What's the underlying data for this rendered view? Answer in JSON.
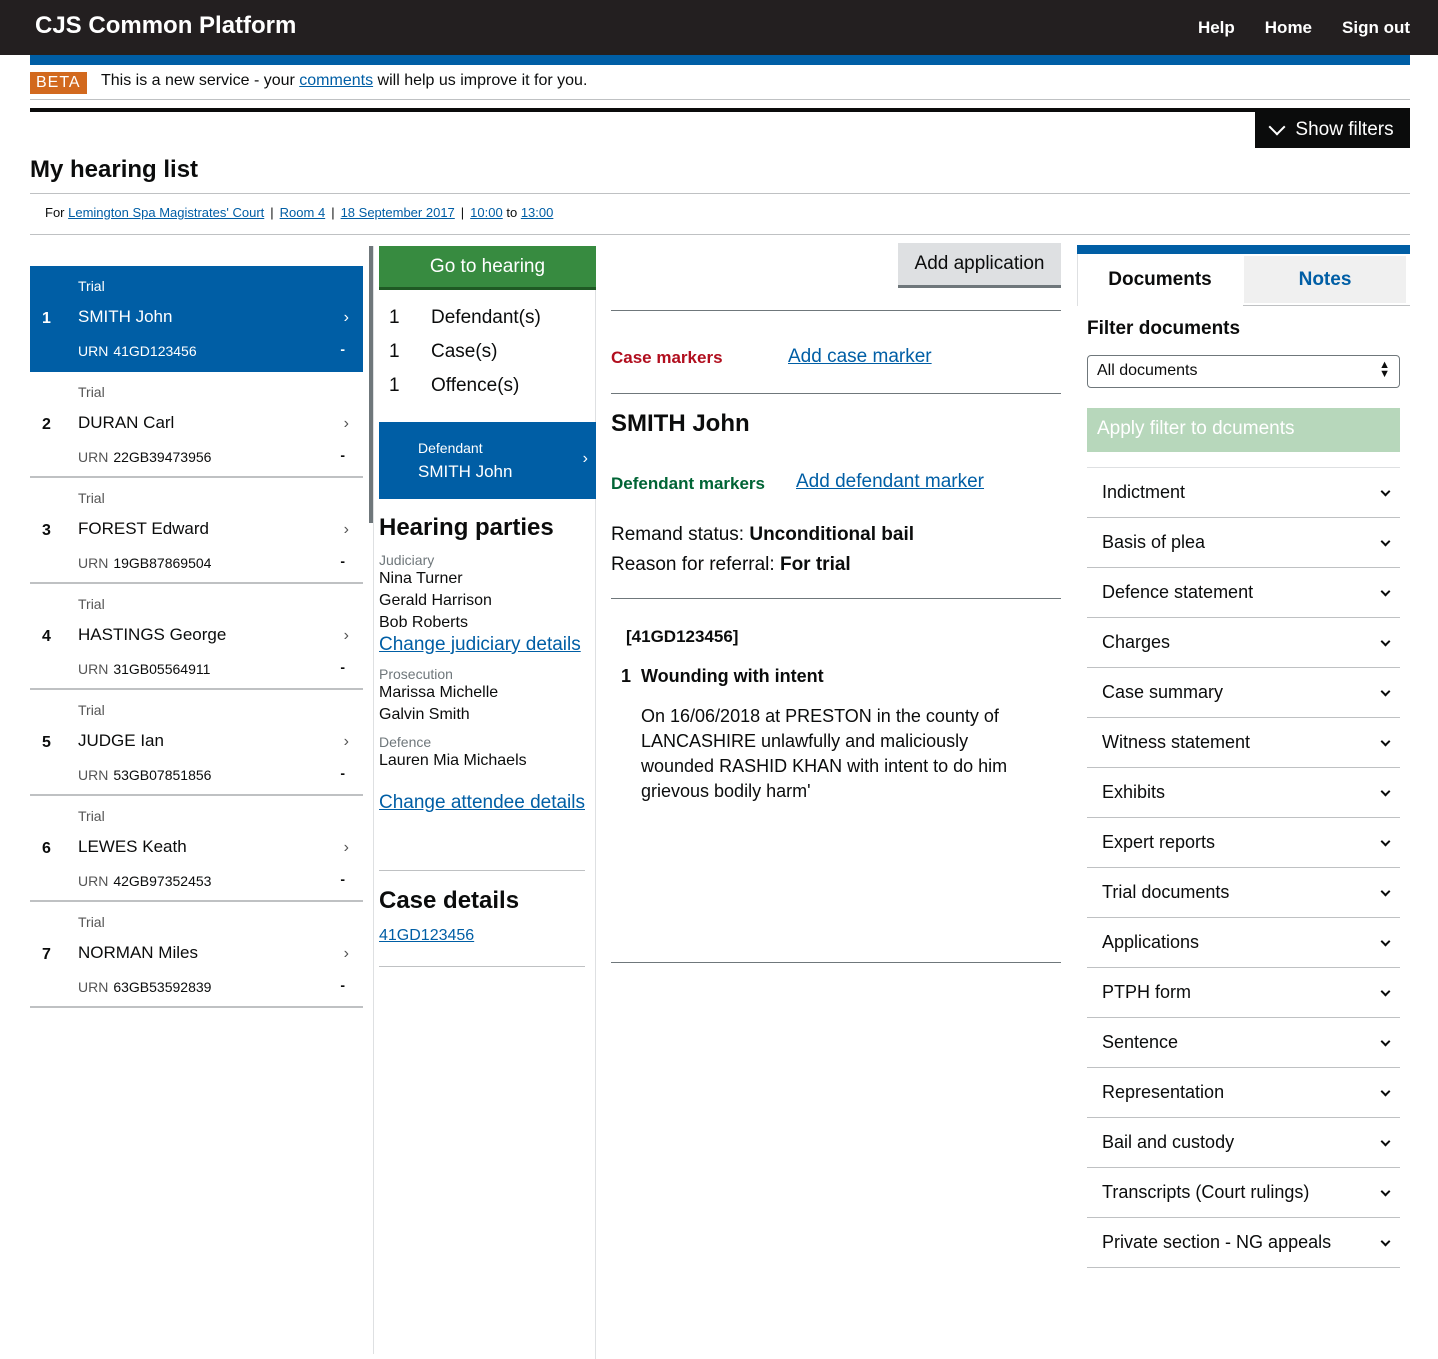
{
  "header": {
    "brand": "CJS Common Platform",
    "nav": [
      "Help",
      "Home",
      "Sign out"
    ],
    "brand_color": "#231f20",
    "accent_color": "#005ea5"
  },
  "beta": {
    "tag": "BETA",
    "text_before": "This is a new service - your ",
    "link": "comments",
    "text_after": " will help us improve it for you."
  },
  "filters": {
    "show_label": "Show filters",
    "icon": "chevron-down-icon"
  },
  "page": {
    "title": "My hearing list",
    "context": {
      "for_label": "For",
      "court": "Lemington Spa Magistrates' Court",
      "room": "Room 4",
      "date": "18 September 2017",
      "start": "10:00",
      "to_label": "to",
      "end": "13:00"
    }
  },
  "hearings": [
    {
      "num": "1",
      "type": "Trial",
      "name": "SMITH John",
      "urn_label": "URN",
      "urn": "41GD123456",
      "status": "-"
    },
    {
      "num": "2",
      "type": "Trial",
      "name": "DURAN Carl",
      "urn_label": "URN",
      "urn": "22GB39473956",
      "status": "-"
    },
    {
      "num": "3",
      "type": "Trial",
      "name": "FOREST Edward",
      "urn_label": "URN",
      "urn": "19GB87869504",
      "status": "-"
    },
    {
      "num": "4",
      "type": "Trial",
      "name": "HASTINGS George",
      "urn_label": "URN",
      "urn": "31GB05564911",
      "status": "-"
    },
    {
      "num": "5",
      "type": "Trial",
      "name": "JUDGE Ian",
      "urn_label": "URN",
      "urn": "53GB07851856",
      "status": "-"
    },
    {
      "num": "6",
      "type": "Trial",
      "name": "LEWES Keath",
      "urn_label": "URN",
      "urn": "42GB97352453",
      "status": "-"
    },
    {
      "num": "7",
      "type": "Trial",
      "name": "NORMAN Miles",
      "urn_label": "URN",
      "urn": "63GB53592839",
      "status": "-"
    }
  ],
  "summary": {
    "go_to_hearing": "Go to hearing",
    "counts": [
      {
        "n": "1",
        "label": "Defendant(s)"
      },
      {
        "n": "1",
        "label": "Case(s)"
      },
      {
        "n": "1",
        "label": "Offence(s)"
      }
    ],
    "defendant_card": {
      "label": "Defendant",
      "name": "SMITH John"
    }
  },
  "parties": {
    "heading": "Hearing parties",
    "judiciary_label": "Judiciary",
    "judiciary": [
      "Nina Turner",
      "Gerald Harrison",
      "Bob Roberts"
    ],
    "change_judiciary": "Change judiciary details",
    "prosecution_label": "Prosecution",
    "prosecution": [
      "Marissa Michelle",
      "Galvin Smith"
    ],
    "defence_label": "Defence",
    "defence": [
      "Lauren Mia Michaels"
    ],
    "change_attendee": "Change attendee details"
  },
  "case_details": {
    "heading": "Case details",
    "link": "41GD123456"
  },
  "detail": {
    "add_application": "Add application",
    "case_markers_label": "Case markers",
    "add_case_marker": "Add case marker",
    "defendant_name": "SMITH John",
    "defendant_markers_label": "Defendant markers",
    "add_defendant_marker": "Add defendant marker",
    "remand_label": "Remand status:",
    "remand_value": "Unconditional bail",
    "referral_label": "Reason for referral:",
    "referral_value": "For trial",
    "case_ref": "[41GD123456]",
    "offence_num": "1",
    "offence_title": "Wounding with intent",
    "offence_desc": "On 16/06/2018 at PRESTON in the county of LANCASHIRE unlawfully and maliciously wounded RASHID KHAN with intent to do him grievous bodily harm'"
  },
  "documents": {
    "tab_documents": "Documents",
    "tab_notes": "Notes",
    "filter_heading": "Filter documents",
    "filter_value": "All documents",
    "apply_button": "Apply filter to dcuments",
    "items": [
      "Indictment",
      "Basis of plea",
      "Defence statement",
      "Charges",
      "Case summary",
      "Witness statement",
      "Exhibits",
      "Expert reports",
      "Trial documents",
      "Applications",
      "PTPH form",
      "Sentence",
      "Representation",
      "Bail and custody",
      "Transcripts (Court rulings)",
      "Private section - NG appeals"
    ]
  }
}
